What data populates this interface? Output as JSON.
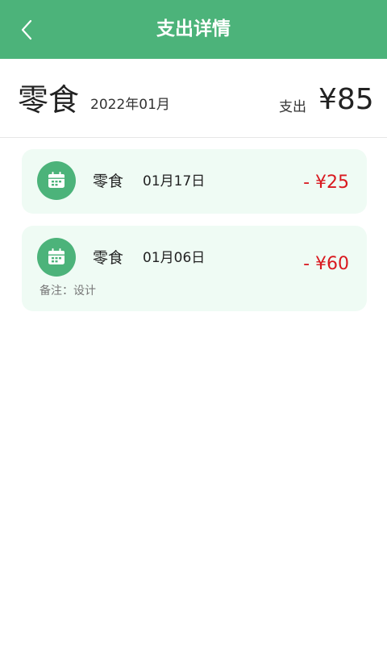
{
  "header": {
    "title": "支出详情"
  },
  "summary": {
    "category": "零食",
    "month": "2022年01月",
    "label": "支出",
    "total": "¥85"
  },
  "records": [
    {
      "category": "零食",
      "date": "01月17日",
      "amount": "- ¥25",
      "note": ""
    },
    {
      "category": "零食",
      "date": "01月06日",
      "amount": "- ¥60",
      "note": "备注：设计"
    }
  ],
  "colors": {
    "brand": "#4cb37a",
    "card_bg": "#effbf4",
    "expense": "#d9191f"
  },
  "icons": {
    "back": "chevron-left-icon",
    "record": "calendar-icon"
  }
}
